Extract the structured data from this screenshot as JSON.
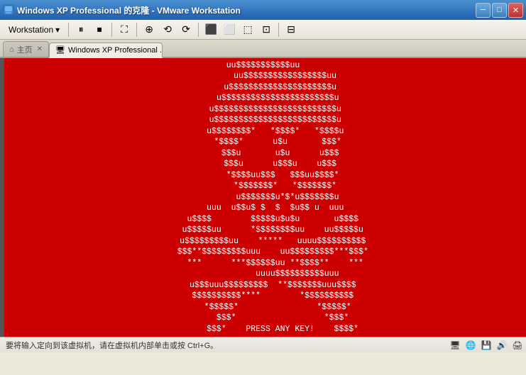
{
  "titlebar": {
    "title": "Windows XP Professional 的克隆 - VMware Workstation",
    "icon": "▣",
    "min_label": "─",
    "max_label": "□",
    "close_label": "✕"
  },
  "menubar": {
    "workstation_label": "Workstation",
    "dropdown_icon": "▾",
    "toolbar_buttons": [
      "⏸",
      "⏹",
      "⛶",
      "⊕",
      "⟲",
      "⟳",
      "⬛",
      "⬜",
      "⬚",
      "⊡",
      "⊟"
    ]
  },
  "tabs": [
    {
      "id": "home",
      "label": "主页",
      "icon": "⌂",
      "active": false,
      "closable": true
    },
    {
      "id": "vm",
      "label": "Windows XP Professional ...",
      "icon": "🖥",
      "active": true,
      "closable": true
    }
  ],
  "skull": {
    "art": "uu$$$$$$$$$$$uu\n         uu$$$$$$$$$$$$$$$$$uu\n       u$$$$$$$$$$$$$$$$$$$$$u\n      u$$$$$$$$$$$$$$$$$$$$$$$u\n     u$$$$$$$$$$$$$$$$$$$$$$$$$u\n     u$$$$$$$$$$$$$$$$$$$$$$$$$u\n     u$$$$$$$$*   *$$$$*   *$$$$u\n      *$$$$*      u$u       $$$*\n       $$$u       u$u      u$$$\n       $$$u      u$$$u    u$$$\n        *$$$$uu$$$   $$$uu$$$$*\n         *$$$$$$$*   *$$$$$$$*\n          u$$$$$$$u*$*u$$$$$$$u\n     uuu  u$$u$ $  $  $u$$ u  uuu\n    u$$$$        $$$$$u$u$u       u$$$$\n    u$$$$$uu      *$$$$$$$$uu    uu$$$$$u\n    u$$$$$$$$$uu    *****   uuuu$$$$$$$$$$\n    $$$**$$$$$$$$$uuu    uu$$$$$$$$$***$$$*\n     ***      ***$$$$$$uu **$$$$**    ***\n              uuuu$$$$$$$$$$uuu\n    u$$$uuu$$$$$$$$$  **$$$$$$$uuu$$$$\n    $$$$$$$$$$****        *$$$$$$$$$$\n      *$$$$$*                *$$$$$*\n        $$$*                  *$$$*\n        $$$*    PRESS ANY KEY!    $$$$*"
  },
  "statusbar": {
    "text": "要将输入定向到该虚拟机，请在虚拟机内部单击或按 Ctrl+G。"
  }
}
